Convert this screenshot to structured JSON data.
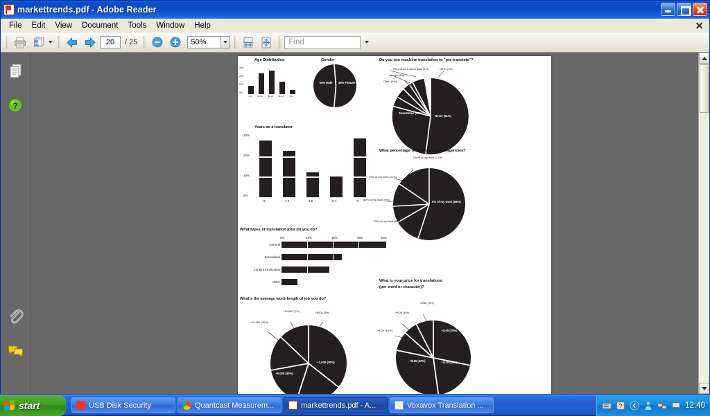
{
  "window": {
    "title": "markettrends.pdf - Adobe Reader",
    "icon": "adobe-reader-icon",
    "minimize_label": "Minimize",
    "maximize_label": "Maximize",
    "close_label": "Close"
  },
  "menu": {
    "items": [
      "File",
      "Edit",
      "View",
      "Document",
      "Tools",
      "Window",
      "Help"
    ]
  },
  "toolbar": {
    "print_icon": "print-icon",
    "email_icon": "email-document-icon",
    "prev_page_icon": "arrow-left-icon",
    "next_page_icon": "arrow-right-icon",
    "page_number": "20",
    "page_total": "/ 25",
    "zoom_out_icon": "zoom-out-icon",
    "zoom_in_icon": "zoom-in-icon",
    "zoom_value": "50%",
    "fit_width_icon": "fit-width-icon",
    "fit_page_icon": "fit-page-icon",
    "find_placeholder": "Find"
  },
  "navpane": {
    "items": [
      {
        "name": "pages-panel-icon",
        "label": "Pages"
      },
      {
        "name": "help-panel-icon",
        "label": "How To"
      },
      {
        "name": "attachments-panel-icon",
        "label": "Attachments"
      },
      {
        "name": "comments-panel-icon",
        "label": "Comments"
      }
    ]
  },
  "scrollbar": {
    "up_icon": "scroll-up-icon",
    "down_icon": "scroll-down-icon"
  },
  "chart_data": [
    {
      "type": "bar",
      "id": "age-distribution",
      "title": "Age Distribution",
      "categories": [
        "<21",
        "21-35",
        "36-44",
        "45-64",
        "65+"
      ],
      "values": [
        10,
        25,
        28,
        15,
        5
      ],
      "ylabel": "",
      "xlabel": "",
      "ytick_labels": [
        "30%",
        "20%",
        "10%",
        "0%"
      ],
      "ylim": [
        0,
        30
      ],
      "grid": false,
      "legend": false
    },
    {
      "type": "pie",
      "id": "gender",
      "title": "Gender",
      "labels": [
        "54% Male",
        "46% Female"
      ],
      "values": [
        54,
        46
      ],
      "legend": false
    },
    {
      "type": "pie",
      "id": "machine-translation",
      "title": "Do you use machine translation to \"pre-translate\"?",
      "labels": [
        "Never (51%)",
        "Sometimes (37%)",
        "Often (4%)",
        "Always (3%)",
        "Only when a client asks (1%)",
        "Other (3%)"
      ],
      "values": [
        51,
        37,
        4,
        3,
        1,
        3
      ],
      "inside_labels": [
        "Never (51%)",
        "Sometimes\n37%"
      ],
      "legend": false
    },
    {
      "type": "bar",
      "id": "years-as-translator",
      "title": "Years as a translator",
      "categories": [
        "<1",
        "1-3",
        "3-5",
        "5-7",
        "7+"
      ],
      "values": [
        27,
        22,
        12,
        10,
        28
      ],
      "ytick_labels": [
        "30%",
        "20%",
        "10%",
        "0%"
      ],
      "ylim": [
        0,
        30
      ],
      "grid": false,
      "legend": false
    },
    {
      "type": "pie",
      "id": "work-via-agencies",
      "title": "What percentage of your work is via agencies?",
      "labels": [
        "0% of my work (55%)",
        "100% of my work (17%)",
        "75% of my work (11%)",
        "50% of my work (9%)",
        "25% of my work (8%)"
      ],
      "values": [
        55,
        17,
        11,
        9,
        8
      ],
      "legend": false
    },
    {
      "type": "bar",
      "id": "translation-job-types",
      "title": "What types of translation jobs do you do?",
      "orientation": "horizontal",
      "categories": [
        "General",
        "Specialized",
        "Content localization",
        "Other"
      ],
      "values": [
        87,
        50,
        40,
        13
      ],
      "xtick_labels": [
        "0%",
        "23%",
        "45%",
        "68%",
        "90%"
      ],
      "xlim": [
        0,
        90
      ],
      "grid": false,
      "legend": false
    },
    {
      "type": "pie",
      "id": "average-word-length",
      "title": "What's the average word-length of job you do?",
      "labels": [
        "+5,000 (40%)",
        "+1,000 (30%)",
        "+500 (13%)",
        "+10,000 (10%)",
        "+10,000 (7%)"
      ],
      "values": [
        40,
        30,
        13,
        10,
        7
      ],
      "legend": false
    },
    {
      "type": "pie",
      "id": "price-per-word",
      "title": "What is your price for translations (per word or character)?",
      "title_line1": "What is your price for translations",
      "title_line2": "(per word or character)?",
      "labels": [
        "+$.10 (35%)",
        "+$.15 (22%)",
        "+$.05 (20%)",
        "+$.20 (10%)",
        "+$.20 (6%)",
        "Other (8%)"
      ],
      "values": [
        35,
        22,
        20,
        10,
        6,
        8
      ],
      "legend": false
    }
  ],
  "taskbar": {
    "start_label": "start",
    "start_icon": "windows-flag-icon",
    "tasks": [
      {
        "label": "USB Disk Security",
        "icon": "usb-disk-security-icon",
        "active": false
      },
      {
        "label": "Quantcast Measurem...",
        "icon": "chrome-icon",
        "active": false
      },
      {
        "label": "markettrends.pdf - A...",
        "icon": "adobe-reader-icon",
        "active": true
      },
      {
        "label": "Voxavox Translation ...",
        "icon": "word-document-icon",
        "active": false
      }
    ],
    "tray_icons": [
      "keyboard-icon",
      "help-tray-icon",
      "chevron-left-icon",
      "messenger-icon",
      "network-icon",
      "monitor-icon"
    ],
    "clock": "12:40"
  }
}
